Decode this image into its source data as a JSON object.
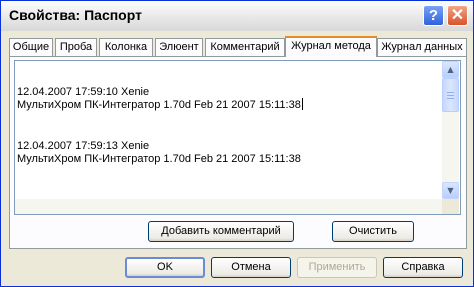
{
  "window": {
    "title": "Свойства: Паспорт",
    "help_glyph": "?",
    "close_glyph": "✕"
  },
  "tabs": [
    {
      "label": "Общие"
    },
    {
      "label": "Проба"
    },
    {
      "label": "Колонка"
    },
    {
      "label": "Элюент"
    },
    {
      "label": "Комментарий"
    },
    {
      "label": "Журнал метода",
      "active": true
    },
    {
      "label": "Журнал данных"
    }
  ],
  "log": {
    "entries": [
      {
        "header": "12.04.2007 17:59:10 Xenie",
        "message": "МультиХром ПК-Интегратор 1.70d Feb 21 2007 15:11:38"
      },
      {
        "header": "12.04.2007 17:59:13 Xenie",
        "message": "МультиХром ПК-Интегратор 1.70d Feb 21 2007 15:11:38"
      }
    ]
  },
  "actions": {
    "add_comment": "Добавить комментарий",
    "clear": "Очистить"
  },
  "footer": {
    "ok": "OK",
    "cancel": "Отмена",
    "apply": "Применить",
    "help": "Справка"
  }
}
